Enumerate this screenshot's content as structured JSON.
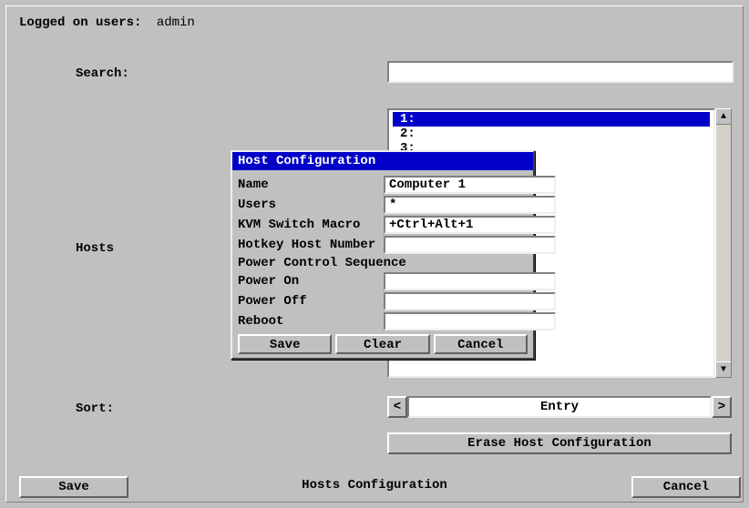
{
  "logged_label": "Logged on users:",
  "logged_value": "admin",
  "search_label": "Search:",
  "search_value": "",
  "hosts_label": "Hosts",
  "list_items": [
    "1:",
    "2:",
    "3:"
  ],
  "list_selected": 0,
  "sort_label": "Sort:",
  "sort_value": "Entry",
  "sort_prev": "<",
  "sort_next": ">",
  "erase_btn": "Erase Host Configuration",
  "save_btn": "Save",
  "cancel_btn": "Cancel",
  "page_title": "Hosts Configuration",
  "scroll_up": "▲",
  "scroll_down": "▼",
  "dialog": {
    "title": "Host Configuration",
    "fields": {
      "name_label": "Name",
      "name_value": "Computer 1",
      "users_label": "Users",
      "users_value": "*",
      "kvm_label": "KVM Switch Macro",
      "kvm_value": "+Ctrl+Alt+1",
      "hotkey_label": "Hotkey Host Number",
      "hotkey_value": "",
      "pcs_label": "Power Control Sequence",
      "pon_label": "Power On",
      "pon_value": "",
      "poff_label": "Power Off",
      "poff_value": "",
      "reboot_label": "Reboot",
      "reboot_value": ""
    },
    "save": "Save",
    "clear": "Clear",
    "cancel": "Cancel"
  }
}
